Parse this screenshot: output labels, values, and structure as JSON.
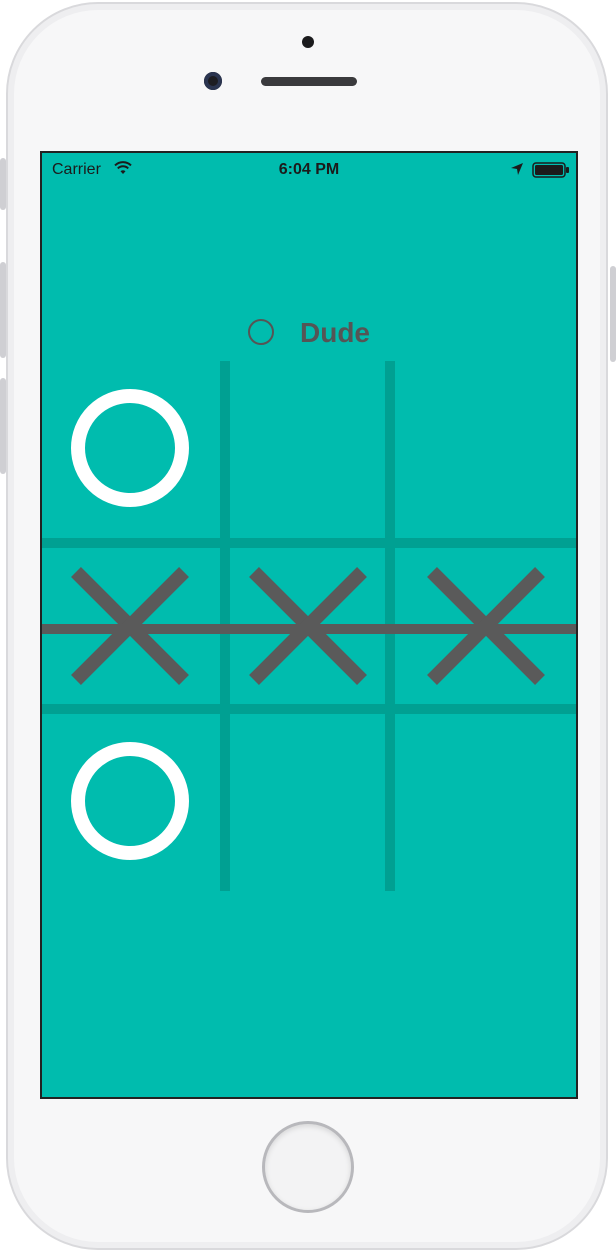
{
  "status_bar": {
    "carrier": "Carrier",
    "time": "6:04 PM"
  },
  "player": {
    "name": "Dude",
    "indicator_icon": "circle-outline-icon"
  },
  "board": {
    "cells": [
      [
        "O",
        "",
        ""
      ],
      [
        "X",
        "X",
        "X"
      ],
      [
        "O",
        "",
        ""
      ]
    ],
    "winning_row": 1
  },
  "colors": {
    "background": "#00bcae",
    "grid": "#00a092",
    "o_mark": "#ffffff",
    "x_mark": "#5a5a5a",
    "text": "#555555"
  },
  "icons": {
    "wifi": "wifi-icon",
    "location": "location-arrow-icon",
    "battery": "battery-icon"
  }
}
